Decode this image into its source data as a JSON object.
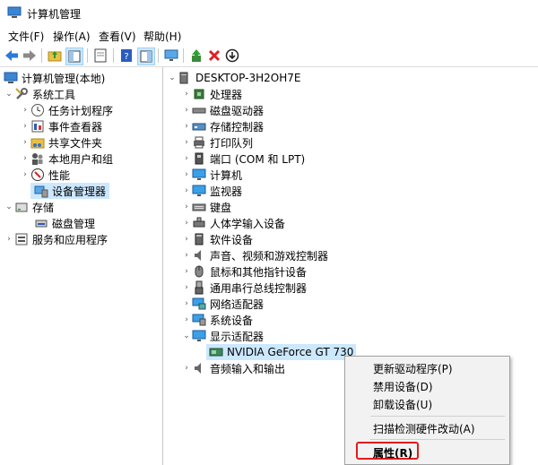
{
  "window": {
    "title": "计算机管理"
  },
  "menu": [
    "文件(F)",
    "操作(A)",
    "查看(V)",
    "帮助(H)"
  ],
  "toolbar_icons": [
    "back-arrow-icon",
    "forward-arrow-icon",
    "folder-up-icon",
    "properties-pane-icon",
    "blank-page-icon",
    "help-icon",
    "show-pane-icon",
    "monitor-icon",
    "update-driver-icon",
    "uninstall-x-icon",
    "disable-device-icon"
  ],
  "left_tree": [
    {
      "label": "计算机管理(本地)",
      "indent": 0,
      "arrow": "",
      "icon": "computer-management-icon"
    },
    {
      "label": "系统工具",
      "indent": 1,
      "arrow": "down",
      "icon": "system-tools-icon"
    },
    {
      "label": "任务计划程序",
      "indent": 2,
      "arrow": "right",
      "icon": "clock-icon"
    },
    {
      "label": "事件查看器",
      "indent": 2,
      "arrow": "right",
      "icon": "event-viewer-icon"
    },
    {
      "label": "共享文件夹",
      "indent": 2,
      "arrow": "right",
      "icon": "shared-folder-icon"
    },
    {
      "label": "本地用户和组",
      "indent": 2,
      "arrow": "right",
      "icon": "users-icon"
    },
    {
      "label": "性能",
      "indent": 2,
      "arrow": "right",
      "icon": "performance-icon"
    },
    {
      "label": "设备管理器",
      "indent": 2,
      "arrow": "",
      "icon": "device-manager-icon"
    },
    {
      "label": "存储",
      "indent": 1,
      "arrow": "down",
      "icon": "storage-icon"
    },
    {
      "label": "磁盘管理",
      "indent": 2,
      "arrow": "",
      "icon": "disk-management-icon"
    },
    {
      "label": "服务和应用程序",
      "indent": 1,
      "arrow": "right",
      "icon": "services-icon"
    }
  ],
  "right_tree": [
    {
      "label": "DESKTOP-3H2OH7E",
      "indent": 0,
      "arrow": "down",
      "icon": "computer-icon"
    },
    {
      "label": "处理器",
      "indent": 1,
      "arrow": "right",
      "icon": "processor-icon"
    },
    {
      "label": "磁盘驱动器",
      "indent": 1,
      "arrow": "right",
      "icon": "disk-drive-icon"
    },
    {
      "label": "存储控制器",
      "indent": 1,
      "arrow": "right",
      "icon": "storage-controller-icon"
    },
    {
      "label": "打印队列",
      "indent": 1,
      "arrow": "right",
      "icon": "printer-icon"
    },
    {
      "label": "端口 (COM 和 LPT)",
      "indent": 1,
      "arrow": "right",
      "icon": "port-icon"
    },
    {
      "label": "计算机",
      "indent": 1,
      "arrow": "right",
      "icon": "monitor-icon"
    },
    {
      "label": "监视器",
      "indent": 1,
      "arrow": "right",
      "icon": "monitor-icon"
    },
    {
      "label": "键盘",
      "indent": 1,
      "arrow": "right",
      "icon": "keyboard-icon"
    },
    {
      "label": "人体学输入设备",
      "indent": 1,
      "arrow": "right",
      "icon": "hid-icon"
    },
    {
      "label": "软件设备",
      "indent": 1,
      "arrow": "right",
      "icon": "software-device-icon"
    },
    {
      "label": "声音、视频和游戏控制器",
      "indent": 1,
      "arrow": "right",
      "icon": "speaker-icon"
    },
    {
      "label": "鼠标和其他指针设备",
      "indent": 1,
      "arrow": "right",
      "icon": "mouse-icon"
    },
    {
      "label": "通用串行总线控制器",
      "indent": 1,
      "arrow": "right",
      "icon": "usb-icon"
    },
    {
      "label": "网络适配器",
      "indent": 1,
      "arrow": "right",
      "icon": "network-adapter-icon"
    },
    {
      "label": "系统设备",
      "indent": 1,
      "arrow": "right",
      "icon": "system-device-icon"
    },
    {
      "label": "显示适配器",
      "indent": 1,
      "arrow": "down",
      "icon": "display-adapter-icon"
    },
    {
      "label": "NVIDIA GeForce GT 730",
      "indent": 2,
      "arrow": "",
      "icon": "gpu-icon"
    },
    {
      "label": "音频输入和输出",
      "indent": 1,
      "arrow": "right",
      "icon": "audio-io-icon"
    }
  ],
  "context_menu": {
    "items": [
      "更新驱动程序(P)",
      "禁用设备(D)",
      "卸载设备(U)",
      "扫描检测硬件改动(A)",
      "属性(R)"
    ]
  },
  "colors": {
    "selection": "#cce8ff",
    "highlight_box": "#e21b1b",
    "menu_bg": "#f2f2f2"
  }
}
